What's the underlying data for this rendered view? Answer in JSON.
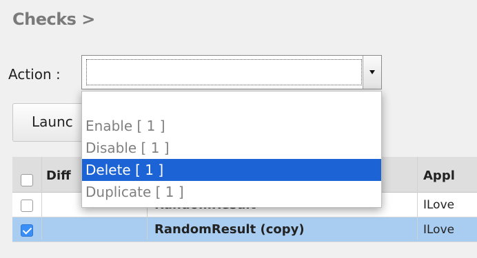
{
  "breadcrumb": "Checks >",
  "action": {
    "label": "Action :",
    "selected_value": ""
  },
  "launch_button": {
    "label": "Launc"
  },
  "table": {
    "columns": [
      "Diff",
      "Appl"
    ],
    "rows": [
      {
        "result": "RandomResult",
        "app": "ILove",
        "checked": false
      },
      {
        "result": "RandomResult (copy)",
        "app": "ILove",
        "checked": true
      }
    ]
  },
  "dropdown": {
    "options": [
      "Enable [ 1 ]",
      "Disable [ 1 ]",
      "Delete [ 1 ]",
      "Duplicate [ 1 ]"
    ],
    "highlighted": "Delete [ 1 ]"
  },
  "colors": {
    "highlight": "#1c63d6",
    "selected_row": "#a9cdf1",
    "checkbox_checked": "#3a8ef8"
  }
}
